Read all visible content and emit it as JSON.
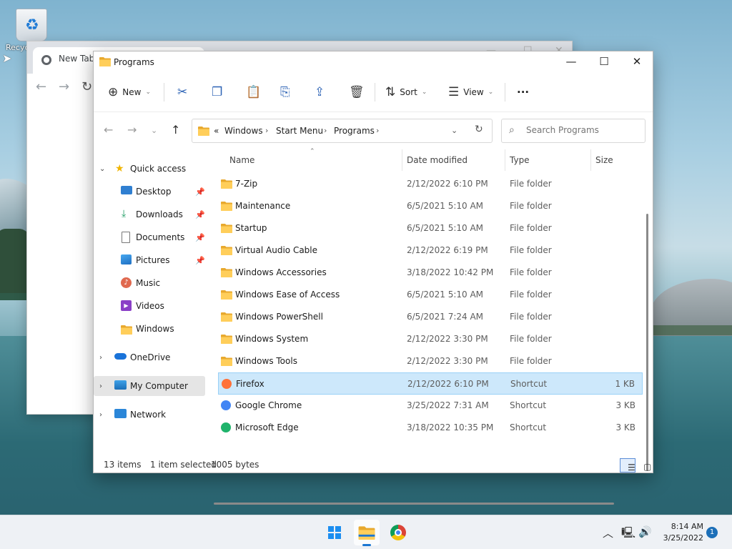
{
  "desktop": {
    "recycle_bin_label": "Recyc"
  },
  "chrome": {
    "tab_title": "New Tab"
  },
  "explorer": {
    "title": "Programs",
    "toolbar": {
      "new_label": "New",
      "sort_label": "Sort",
      "view_label": "View",
      "more_label": "···"
    },
    "address": {
      "overflow": "«",
      "segments": [
        "Windows",
        "Start Menu",
        "Programs"
      ]
    },
    "search": {
      "placeholder": "Search Programs"
    },
    "nav": {
      "quick_access": "Quick access",
      "desktop": "Desktop",
      "downloads": "Downloads",
      "documents": "Documents",
      "pictures": "Pictures",
      "music": "Music",
      "videos": "Videos",
      "windows": "Windows",
      "onedrive": "OneDrive",
      "my_computer": "My Computer",
      "network": "Network"
    },
    "columns": {
      "name": "Name",
      "date": "Date modified",
      "type": "Type",
      "size": "Size"
    },
    "files": [
      {
        "name": "7-Zip",
        "date": "2/12/2022 6:10 PM",
        "type": "File folder",
        "size": ""
      },
      {
        "name": "Maintenance",
        "date": "6/5/2021 5:10 AM",
        "type": "File folder",
        "size": ""
      },
      {
        "name": "Startup",
        "date": "6/5/2021 5:10 AM",
        "type": "File folder",
        "size": ""
      },
      {
        "name": "Virtual Audio Cable",
        "date": "2/12/2022 6:19 PM",
        "type": "File folder",
        "size": ""
      },
      {
        "name": "Windows Accessories",
        "date": "3/18/2022 10:42 PM",
        "type": "File folder",
        "size": ""
      },
      {
        "name": "Windows Ease of Access",
        "date": "6/5/2021 5:10 AM",
        "type": "File folder",
        "size": ""
      },
      {
        "name": "Windows PowerShell",
        "date": "6/5/2021 7:24 AM",
        "type": "File folder",
        "size": ""
      },
      {
        "name": "Windows System",
        "date": "2/12/2022 3:30 PM",
        "type": "File folder",
        "size": ""
      },
      {
        "name": "Windows Tools",
        "date": "2/12/2022 3:30 PM",
        "type": "File folder",
        "size": ""
      },
      {
        "name": "Firefox",
        "date": "2/12/2022 6:10 PM",
        "type": "Shortcut",
        "size": "1 KB"
      },
      {
        "name": "Google Chrome",
        "date": "3/25/2022 7:31 AM",
        "type": "Shortcut",
        "size": "3 KB"
      },
      {
        "name": "Microsoft Edge",
        "date": "3/18/2022 10:35 PM",
        "type": "Shortcut",
        "size": "3 KB"
      }
    ],
    "status": {
      "count": "13 items",
      "selected": "1 item selected",
      "bytes": "1005 bytes"
    }
  },
  "taskbar": {
    "time": "8:14 AM",
    "date": "3/25/2022",
    "notifications": "1"
  }
}
